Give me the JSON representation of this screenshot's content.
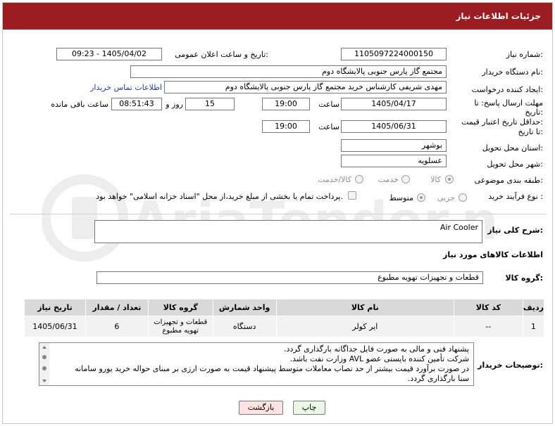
{
  "header": {
    "title": "جزئیات اطلاعات نیاز"
  },
  "form": {
    "need_number": {
      "label": "شماره نیاز:",
      "value": "1105097224000150"
    },
    "announce": {
      "label": "تاریخ و ساعت اعلان عمومی:",
      "value": "1405/04/02 - 09:23"
    },
    "buyer_org": {
      "label": "نام دستگاه خریدار:",
      "value": "مجتمع گاز پارس جنوبی  پالایشگاه دوم"
    },
    "creator": {
      "label": "ایجاد کننده درخواست:",
      "value": "مهدی شریفی کارشناس خرید مجتمع گاز پارس جنوبی  پالایشگاه دوم",
      "link": "اطلاعات تماس خریدار"
    },
    "reply_deadline": {
      "label_line1": "مهلت ارسال پاسخ: تا",
      "label_line2": "تاریخ:",
      "date": "1405/04/17",
      "time_label": "ساعت",
      "time": "19:00",
      "days": "15",
      "days_label": "روز و",
      "remaining": "08:51:43",
      "remaining_label": "ساعت باقی مانده"
    },
    "price_validity": {
      "label_line1": "حداقل تاریخ اعتبار قیمت:",
      "label_line2": "تا تاریخ:",
      "date": "1405/06/31",
      "time_label": "ساعت",
      "time": "19:00"
    },
    "province": {
      "label": "استان محل تحویل:",
      "value": "بوشهر"
    },
    "city": {
      "label": "شهر محل تحویل:",
      "value": "عسلویه"
    },
    "category": {
      "label": "طبقه بندی موضوعی:",
      "options": [
        "کالا",
        "خدمت",
        "کالا/خدمت"
      ],
      "selected": "کالا"
    },
    "process": {
      "label": "نوع فرآیند خرید :",
      "options": [
        "جزیی",
        "متوسط"
      ],
      "selected": "متوسط",
      "payment_note": "پرداخت تمام یا بخشی از مبلغ خرید،از محل \"اسناد خزانه اسلامی\" خواهد بود."
    }
  },
  "summary": {
    "label": "شرح کلی نیاز:",
    "value": "Air Cooler"
  },
  "goods_section": {
    "title": "اطلاعات کالاهای مورد نیاز",
    "group_label": "گروه کالا:",
    "group_value": "قطعات و تجهیزات تهویه مطبوع"
  },
  "table": {
    "headers": [
      "ردیف",
      "کد کالا",
      "نام کالا",
      "واحد شمارش",
      "گروه کالا",
      "تعداد / مقدار",
      "تاریخ نیاز"
    ],
    "rows": [
      [
        "1",
        "--",
        "ایر کولر",
        "دستگاه",
        "قطعات و تجهیزات تهویه مطبوع",
        "6",
        "1405/06/31"
      ]
    ]
  },
  "buyer_notes": {
    "label": "توضیحات خریدار:",
    "lines": [
      "پشنهاد فنی و مالی به صورت فایل جداگانه بارگذاری گردد.",
      "شرکت تأمین کننده بایستی عضو AVL وزارت نفت باشد.",
      "در صورت برآورد قیمت بیشتر از حد نصاب معاملات متوسط پیشنهاد قیمت به صورت ارزی بر مبنای حواله خرید یورو سامانه",
      "سنا بارگذاری گردد."
    ]
  },
  "buttons": {
    "print": "چاپ",
    "back": "بازگشت"
  },
  "watermark": {
    "text": "AriaTender.neT"
  },
  "colors": {
    "header_bg": "#9b1d22",
    "link": "#1e3fae",
    "back_button_bg": "#fbe3e3",
    "print_button_bg": "#eaf7e6"
  }
}
